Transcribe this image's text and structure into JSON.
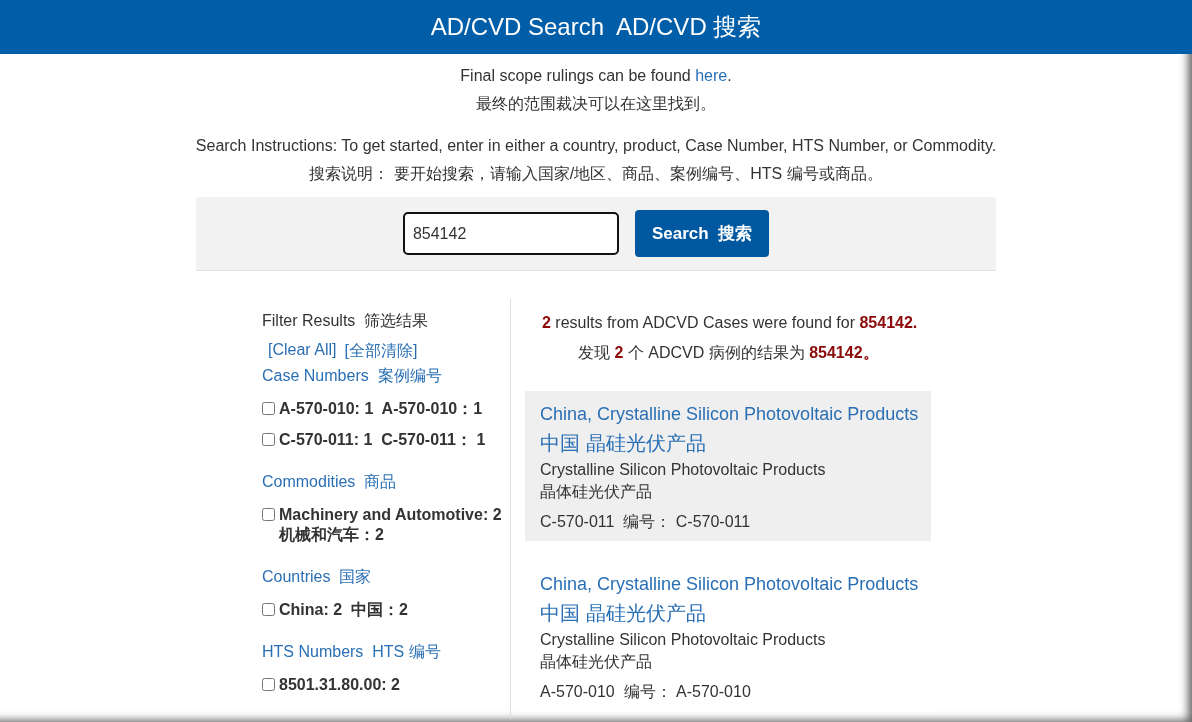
{
  "header": {
    "title": "AD/CVD Search  AD/CVD 搜索"
  },
  "intro": {
    "scope_text": "Final scope rulings can be found ",
    "scope_link": "here",
    "scope_end": ".",
    "scope_zh": "最终的范围裁决可以在这里找到。",
    "instructions": "Search Instructions: To get started, enter in either a country, product, Case Number, HTS Number, or Commodity.",
    "instructions_zh": "搜索说明： 要开始搜索，请输入国家/地区、商品、案例编号、HTS 编号或商品。"
  },
  "search": {
    "value": "854142",
    "button": "Search  搜索"
  },
  "filters": {
    "title": "Filter Results  筛选结果",
    "clear_links": [
      "[Clear All]",
      "[全部清除]"
    ],
    "groups": [
      {
        "heading": "Case Numbers  案例编号",
        "options": [
          {
            "label": "A-570-010: 1  A-570-010：1",
            "checked": false
          },
          {
            "label": "C-570-011: 1  C-570-011： 1",
            "checked": false
          }
        ]
      },
      {
        "heading": "Commodities  商品",
        "options": [
          {
            "label": "Machinery and Automotive: 2 机械和汽车：2",
            "checked": false
          }
        ]
      },
      {
        "heading": "Countries  国家",
        "options": [
          {
            "label": "China: 2  中国：2",
            "checked": false
          }
        ]
      },
      {
        "heading": "HTS Numbers  HTS 编号",
        "options": [
          {
            "label": "8501.31.80.00: 2",
            "checked": false
          }
        ]
      }
    ]
  },
  "results": {
    "summary": "**2** results from ADCVD Cases were found for **854142.**",
    "summary_zh": "发现 **2** 个 ADCVD 病例的结果为 **854142。**",
    "items": [
      {
        "title": "China, Crystalline Silicon Photovoltaic Products",
        "title_zh": "中国 晶硅光伏产品",
        "subtitle": "Crystalline Silicon Photovoltaic Products",
        "subtitle_zh": "晶体硅光伏产品",
        "case": "C-570-011  编号： C-570-011",
        "highlighted": true
      },
      {
        "title": "China, Crystalline Silicon Photovoltaic Products",
        "title_zh": "中国 晶硅光伏产品",
        "subtitle": "Crystalline Silicon Photovoltaic Products",
        "subtitle_zh": "晶体硅光伏产品",
        "case": "A-570-010  编号： A-570-010",
        "highlighted": false
      }
    ]
  }
}
